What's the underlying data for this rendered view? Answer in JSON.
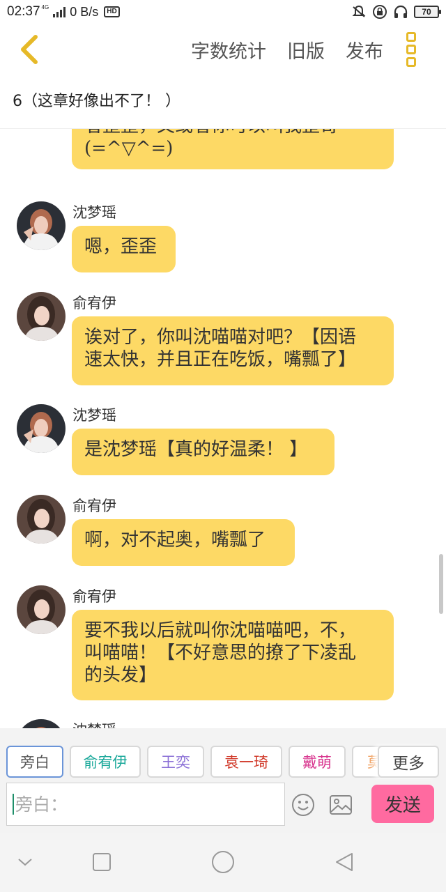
{
  "status_bar": {
    "time": "02:37",
    "network": "4G",
    "speed": "0 B/s",
    "hd": "HD",
    "battery": "70"
  },
  "header": {
    "actions": [
      "字数统计",
      "旧版",
      "发布"
    ]
  },
  "chapter_title": "6（这章好像出不了！ ）",
  "messages": [
    {
      "speaker": "",
      "text": "者歪歪，又或者你可以叫我歪哥\n(=^▽^=)",
      "partial": true
    },
    {
      "speaker": "沈梦瑶",
      "text": "嗯，歪歪",
      "avatar": "avatar-shen"
    },
    {
      "speaker": "俞宥伊",
      "text": "诶对了，你叫沈喵喵对吧？【因语\n速太快，并且正在吃饭，嘴瓢了】",
      "avatar": "avatar-yu"
    },
    {
      "speaker": "沈梦瑶",
      "text": "是沈梦瑶【真的好温柔！ 】",
      "avatar": "avatar-shen"
    },
    {
      "speaker": "俞宥伊",
      "text": "啊，对不起奥，嘴瓢了",
      "avatar": "avatar-yu"
    },
    {
      "speaker": "俞宥伊",
      "text": "要不我以后就叫你沈喵喵吧，不，\n叫喵喵！【不好意思的撩了下凌乱\n的头发】",
      "avatar": "avatar-yu"
    },
    {
      "speaker": "沈梦瑶",
      "text": "",
      "partial": true,
      "avatar": "avatar-shen"
    }
  ],
  "roles": [
    {
      "label": "旁白",
      "color": "#555555",
      "active": true
    },
    {
      "label": "俞宥伊",
      "color": "#1aa89a"
    },
    {
      "label": "王奕",
      "color": "#8a6fd6"
    },
    {
      "label": "袁一琦",
      "color": "#d13a2a"
    },
    {
      "label": "戴萌",
      "color": "#d8358e"
    },
    {
      "label": "莫",
      "color": "#f0a060"
    }
  ],
  "more_roles_label": "更多",
  "input": {
    "placeholder": "旁白：",
    "value": ""
  },
  "send_label": "发送",
  "colors": {
    "accent": "#fdd965",
    "send": "#ff6aa0",
    "icon": "#e6b928"
  }
}
